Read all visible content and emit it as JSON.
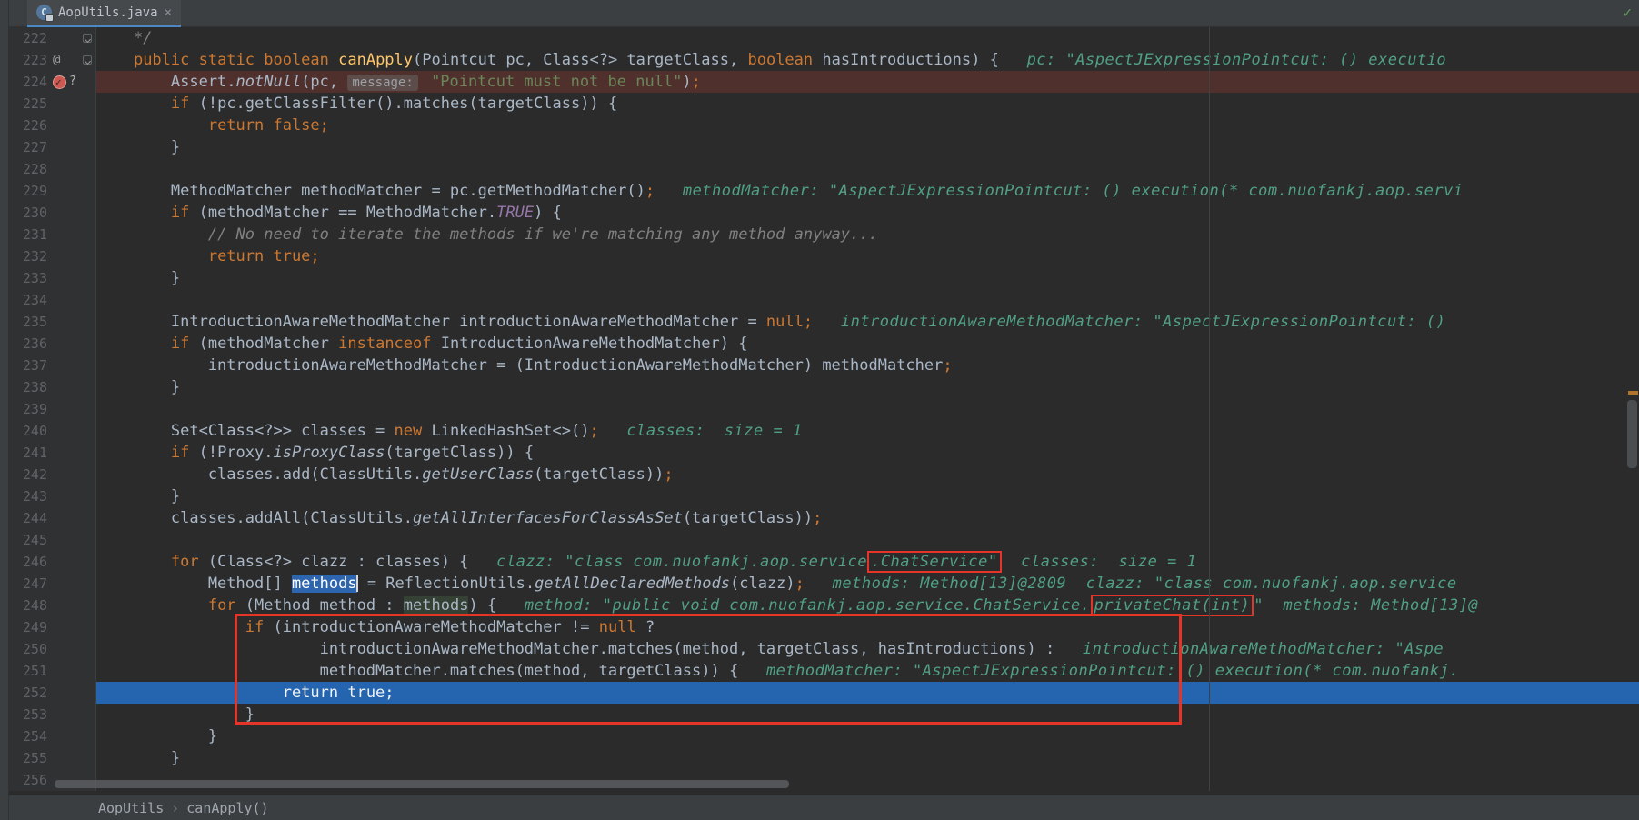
{
  "window": {
    "tab": {
      "title": "AopUtils.java",
      "close_glyph": "×",
      "class_icon_glyph": "C"
    },
    "inspection_ok_glyph": "✓"
  },
  "breadcrumbs": {
    "items": [
      "AopUtils",
      "canApply()"
    ],
    "separator": "›"
  },
  "colors": {
    "editor_bg": "#2b2b2b",
    "gutter_bg": "#2f3133",
    "topbar_bg": "#3c3f41",
    "keyword": "#cc7832",
    "string": "#6a8759",
    "comment": "#808080",
    "hint": "#50a082",
    "annotation_red": "#e53529",
    "exec_line": "#2565b0",
    "breakpoint_line": "#50302d",
    "selection": "#2d65af",
    "tab_underline": "#4a88c7"
  },
  "editor": {
    "lines": [
      {
        "num": 222,
        "icons": [
          {
            "name": "fold-marker-icon"
          }
        ],
        "segs": [
          {
            "t": "    */",
            "c": "cm"
          }
        ]
      },
      {
        "num": 223,
        "icons": [
          {
            "name": "at-icon",
            "glyph": "@"
          },
          {
            "name": "fold-marker-icon"
          }
        ],
        "segs": [
          {
            "t": "    ",
            "c": "d"
          },
          {
            "t": "public static boolean ",
            "c": "k"
          },
          {
            "t": "canApply",
            "c": "m"
          },
          {
            "t": "(Pointcut pc, Class<?> targetClass, ",
            "c": "d"
          },
          {
            "t": "boolean",
            "c": "k"
          },
          {
            "t": " hasIntroductions) {",
            "c": "d"
          },
          {
            "t": "   ",
            "c": "d"
          },
          {
            "t": "pc: \"AspectJExpressionPointcut: () executio",
            "c": "h"
          }
        ]
      },
      {
        "num": 224,
        "bg": "bp",
        "icons": [
          {
            "name": "breakpoint-icon"
          },
          {
            "name": "question-mark-icon",
            "glyph": "?"
          }
        ],
        "segs": [
          {
            "t": "        Assert.",
            "c": "d"
          },
          {
            "t": "notNull",
            "c": "i"
          },
          {
            "t": "(pc, ",
            "c": "d"
          },
          {
            "t": "message:",
            "c": "chip"
          },
          {
            "t": " ",
            "c": "d"
          },
          {
            "t": "\"Pointcut must not be null\"",
            "c": "s"
          },
          {
            "t": ")",
            "c": "d"
          },
          {
            "t": ";",
            "c": "k"
          }
        ]
      },
      {
        "num": 225,
        "segs": [
          {
            "t": "        ",
            "c": "d"
          },
          {
            "t": "if",
            "c": "k"
          },
          {
            "t": " (!pc.getClassFilter().matches(targetClass)) {",
            "c": "d"
          }
        ]
      },
      {
        "num": 226,
        "segs": [
          {
            "t": "            ",
            "c": "d"
          },
          {
            "t": "return false;",
            "c": "k"
          }
        ]
      },
      {
        "num": 227,
        "segs": [
          {
            "t": "        }",
            "c": "d"
          }
        ]
      },
      {
        "num": 228,
        "segs": []
      },
      {
        "num": 229,
        "segs": [
          {
            "t": "        MethodMatcher methodMatcher = pc.getMethodMatcher()",
            "c": "d"
          },
          {
            "t": ";",
            "c": "k"
          },
          {
            "t": "   ",
            "c": "d"
          },
          {
            "t": "methodMatcher: \"AspectJExpressionPointcut: () execution(* com.nuofankj.aop.servi",
            "c": "h"
          }
        ]
      },
      {
        "num": 230,
        "segs": [
          {
            "t": "        ",
            "c": "d"
          },
          {
            "t": "if",
            "c": "k"
          },
          {
            "t": " (methodMatcher == MethodMatcher.",
            "c": "d"
          },
          {
            "t": "TRUE",
            "c": "f"
          },
          {
            "t": ") {",
            "c": "d"
          }
        ]
      },
      {
        "num": 231,
        "segs": [
          {
            "t": "            ",
            "c": "d"
          },
          {
            "t": "// No need to iterate the methods if we're matching any method anyway...",
            "c": "cm"
          }
        ]
      },
      {
        "num": 232,
        "segs": [
          {
            "t": "            ",
            "c": "d"
          },
          {
            "t": "return true;",
            "c": "k"
          }
        ]
      },
      {
        "num": 233,
        "segs": [
          {
            "t": "        }",
            "c": "d"
          }
        ]
      },
      {
        "num": 234,
        "segs": []
      },
      {
        "num": 235,
        "segs": [
          {
            "t": "        IntroductionAwareMethodMatcher introductionAwareMethodMatcher = ",
            "c": "d"
          },
          {
            "t": "null",
            "c": "k"
          },
          {
            "t": ";",
            "c": "k"
          },
          {
            "t": "   ",
            "c": "d"
          },
          {
            "t": "introductionAwareMethodMatcher: \"AspectJExpressionPointcut: ()",
            "c": "h"
          }
        ]
      },
      {
        "num": 236,
        "segs": [
          {
            "t": "        ",
            "c": "d"
          },
          {
            "t": "if",
            "c": "k"
          },
          {
            "t": " (methodMatcher ",
            "c": "d"
          },
          {
            "t": "instanceof",
            "c": "k"
          },
          {
            "t": " IntroductionAwareMethodMatcher) {",
            "c": "d"
          }
        ]
      },
      {
        "num": 237,
        "segs": [
          {
            "t": "            introductionAwareMethodMatcher = (IntroductionAwareMethodMatcher) methodMatcher",
            "c": "d"
          },
          {
            "t": ";",
            "c": "k"
          }
        ]
      },
      {
        "num": 238,
        "segs": [
          {
            "t": "        }",
            "c": "d"
          }
        ]
      },
      {
        "num": 239,
        "segs": []
      },
      {
        "num": 240,
        "segs": [
          {
            "t": "        Set<Class<?>> classes = ",
            "c": "d"
          },
          {
            "t": "new",
            "c": "k"
          },
          {
            "t": " LinkedHashSet<>()",
            "c": "d"
          },
          {
            "t": ";",
            "c": "k"
          },
          {
            "t": "   ",
            "c": "d"
          },
          {
            "t": "classes:  size = 1",
            "c": "h"
          }
        ]
      },
      {
        "num": 241,
        "segs": [
          {
            "t": "        ",
            "c": "d"
          },
          {
            "t": "if",
            "c": "k"
          },
          {
            "t": " (!Proxy.",
            "c": "d"
          },
          {
            "t": "isProxyClass",
            "c": "i"
          },
          {
            "t": "(targetClass)) {",
            "c": "d"
          }
        ]
      },
      {
        "num": 242,
        "segs": [
          {
            "t": "            classes.add(ClassUtils.",
            "c": "d"
          },
          {
            "t": "getUserClass",
            "c": "i"
          },
          {
            "t": "(targetClass))",
            "c": "d"
          },
          {
            "t": ";",
            "c": "k"
          }
        ]
      },
      {
        "num": 243,
        "segs": [
          {
            "t": "        }",
            "c": "d"
          }
        ]
      },
      {
        "num": 244,
        "segs": [
          {
            "t": "        classes.addAll(ClassUtils.",
            "c": "d"
          },
          {
            "t": "getAllInterfacesForClassAsSet",
            "c": "i"
          },
          {
            "t": "(targetClass))",
            "c": "d"
          },
          {
            "t": ";",
            "c": "k"
          }
        ]
      },
      {
        "num": 245,
        "segs": []
      },
      {
        "num": 246,
        "segs": [
          {
            "t": "        ",
            "c": "d"
          },
          {
            "t": "for",
            "c": "k"
          },
          {
            "t": " (Class<?> clazz : classes) {",
            "c": "d"
          },
          {
            "t": "   ",
            "c": "d"
          },
          {
            "t": "clazz: \"class com.nuofankj.aop.service",
            "c": "h"
          },
          {
            "t": ".ChatService\"",
            "c": "hb"
          },
          {
            "t": "  classes:  size = 1",
            "c": "h"
          }
        ]
      },
      {
        "num": 247,
        "segs": [
          {
            "t": "            Method[] ",
            "c": "d"
          },
          {
            "t": "methods",
            "c": "sel",
            "caret": true
          },
          {
            "t": " = ReflectionUtils.",
            "c": "d"
          },
          {
            "t": "getAllDeclaredMethods",
            "c": "i"
          },
          {
            "t": "(clazz)",
            "c": "d"
          },
          {
            "t": ";",
            "c": "k"
          },
          {
            "t": "   ",
            "c": "d"
          },
          {
            "t": "methods: Method[13]@2809  clazz: \"class com.nuofankj.aop.service",
            "c": "h"
          }
        ]
      },
      {
        "num": 248,
        "segs": [
          {
            "t": "            ",
            "c": "d"
          },
          {
            "t": "for",
            "c": "k"
          },
          {
            "t": " (Method method : ",
            "c": "d"
          },
          {
            "t": "methods",
            "c": "idhl"
          },
          {
            "t": ") {",
            "c": "d"
          },
          {
            "t": "   ",
            "c": "d"
          },
          {
            "t": "method: \"public void com.nuofankj.aop.service.ChatService.",
            "c": "h"
          },
          {
            "t": "privateChat(int)",
            "c": "hb"
          },
          {
            "t": "\"  methods: Method[13]@",
            "c": "h"
          }
        ]
      },
      {
        "num": 249,
        "segs": [
          {
            "t": "                ",
            "c": "d"
          },
          {
            "t": "if",
            "c": "k"
          },
          {
            "t": " (introductionAwareMethodMatcher != ",
            "c": "d"
          },
          {
            "t": "null",
            "c": "k"
          },
          {
            "t": " ?",
            "c": "d"
          }
        ]
      },
      {
        "num": 250,
        "segs": [
          {
            "t": "                        introductionAwareMethodMatcher.matches(method, targetClass, hasIntroductions) :",
            "c": "d"
          },
          {
            "t": "   ",
            "c": "d"
          },
          {
            "t": "introductionAwareMethodMatcher: \"Aspe",
            "c": "h"
          }
        ]
      },
      {
        "num": 251,
        "segs": [
          {
            "t": "                        methodMatcher.matches(method, targetClass)) {",
            "c": "d"
          },
          {
            "t": "   ",
            "c": "d"
          },
          {
            "t": "methodMatcher: \"AspectJExpressionPointcut: () execution(* com.nuofankj.",
            "c": "h"
          }
        ]
      },
      {
        "num": 252,
        "bg": "exec",
        "segs": [
          {
            "t": "                    ",
            "c": "d"
          },
          {
            "t": "return true;",
            "c": "x"
          }
        ]
      },
      {
        "num": 253,
        "segs": [
          {
            "t": "                }",
            "c": "d"
          }
        ]
      },
      {
        "num": 254,
        "segs": [
          {
            "t": "            }",
            "c": "d"
          }
        ]
      },
      {
        "num": 255,
        "segs": [
          {
            "t": "        }",
            "c": "d"
          }
        ]
      },
      {
        "num": 256,
        "segs": []
      }
    ]
  }
}
